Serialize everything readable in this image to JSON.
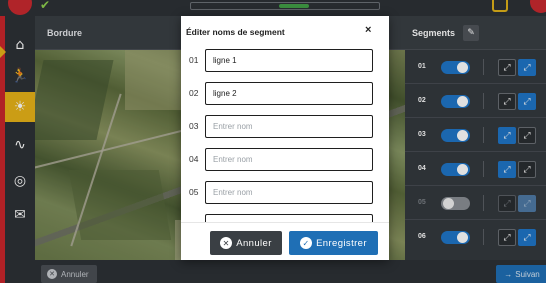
{
  "map_panel": {
    "title": "Bordure"
  },
  "segments_panel": {
    "title": "Segments",
    "rows": [
      {
        "number": "01",
        "enabled": true
      },
      {
        "number": "02",
        "enabled": true
      },
      {
        "number": "03",
        "enabled": true
      },
      {
        "number": "04",
        "enabled": true
      },
      {
        "number": "05",
        "enabled": false
      },
      {
        "number": "06",
        "enabled": true
      }
    ]
  },
  "modal": {
    "title": "Éditer noms de segment",
    "close_symbol": "×",
    "fields": [
      {
        "number": "01",
        "value": "ligne 1",
        "placeholder": "Entrer nom"
      },
      {
        "number": "02",
        "value": "ligne 2",
        "placeholder": "Entrer nom"
      },
      {
        "number": "03",
        "value": "",
        "placeholder": "Entrer nom"
      },
      {
        "number": "04",
        "value": "",
        "placeholder": "Entrer nom"
      },
      {
        "number": "05",
        "value": "",
        "placeholder": "Entrer nom"
      }
    ],
    "cancel_label": "Annuler",
    "save_label": "Enregistrer"
  },
  "bottom_bar": {
    "cancel_label": "Annuler",
    "next_label": "Suivan"
  },
  "colors": {
    "primary": "#1f6fb5",
    "accent": "#e8b318",
    "brand": "#c9262c",
    "toggle_on": "#1f76c8"
  },
  "icons": {
    "sidebar": [
      "home-icon",
      "runner-icon",
      "sun-icon",
      "pulse-icon",
      "settings-icon",
      "mail-icon"
    ],
    "segment_direction": [
      "arrow-diagonal-icon",
      "arrow-diagonal-icon"
    ]
  }
}
